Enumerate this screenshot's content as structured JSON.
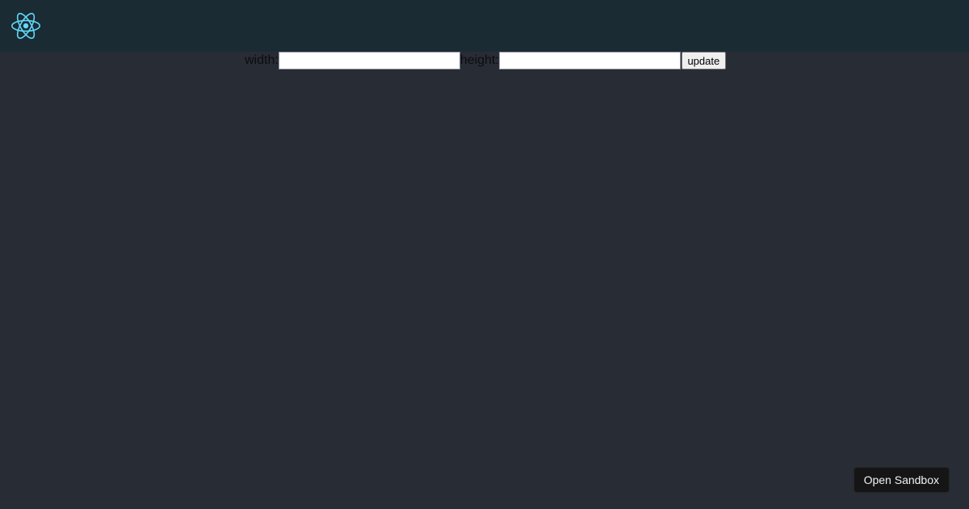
{
  "header": {
    "logo_icon": "react-atom-icon",
    "logo_color": "#61dafb",
    "background": "#1a2b33"
  },
  "form": {
    "width_label": "width:",
    "width_value": "",
    "height_label": "height:",
    "height_value": "",
    "update_label": "update"
  },
  "footer": {
    "open_sandbox_label": "Open Sandbox"
  },
  "colors": {
    "page_background": "#282c34"
  }
}
